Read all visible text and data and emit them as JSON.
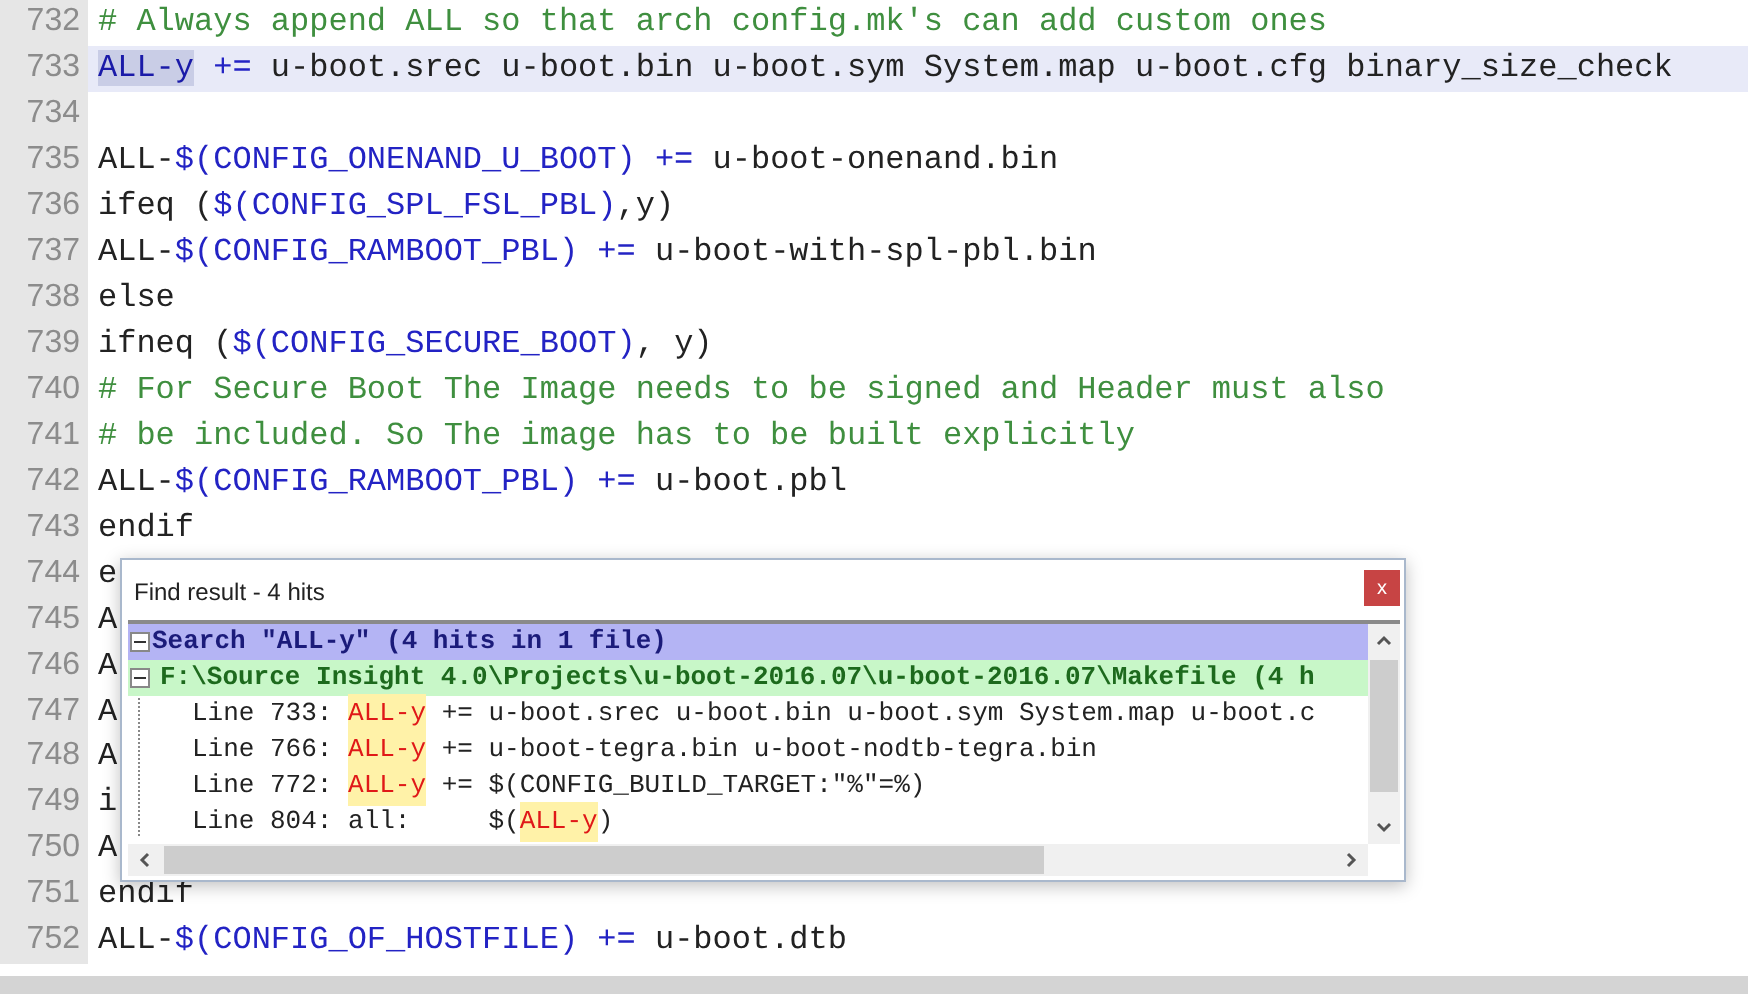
{
  "editor": {
    "lines": [
      {
        "number": "732",
        "current": false,
        "segments": [
          {
            "text": "# Always append ALL so that arch config.mk's can add custom ones",
            "kind": "comment"
          }
        ]
      },
      {
        "number": "733",
        "current": true,
        "segments": [
          {
            "text": "ALL-y",
            "kind": "selected"
          },
          {
            "text": " +=",
            "kind": "op"
          },
          {
            "text": " u-boot.srec u-boot.bin u-boot.sym System.map u-boot.cfg binary_size_check",
            "kind": "plain"
          }
        ]
      },
      {
        "number": "734",
        "current": false
      },
      {
        "number": "735",
        "current": false,
        "segments": [
          {
            "text": "ALL-",
            "kind": "plain"
          },
          {
            "text": "$(CONFIG_ONENAND_U_BOOT)",
            "kind": "var"
          },
          {
            "text": " +=",
            "kind": "op"
          },
          {
            "text": " u-boot-onenand.bin",
            "kind": "plain"
          }
        ]
      },
      {
        "number": "736",
        "current": false,
        "segments": [
          {
            "text": "ifeq (",
            "kind": "plain"
          },
          {
            "text": "$(CONFIG_SPL_FSL_PBL)",
            "kind": "var"
          },
          {
            "text": ",y)",
            "kind": "plain"
          }
        ]
      },
      {
        "number": "737",
        "current": false,
        "segments": [
          {
            "text": "ALL-",
            "kind": "plain"
          },
          {
            "text": "$(CONFIG_RAMBOOT_PBL)",
            "kind": "var"
          },
          {
            "text": " +=",
            "kind": "op"
          },
          {
            "text": " u-boot-with-spl-pbl.bin",
            "kind": "plain"
          }
        ]
      },
      {
        "number": "738",
        "current": false,
        "segments": [
          {
            "text": "else",
            "kind": "plain"
          }
        ]
      },
      {
        "number": "739",
        "current": false,
        "segments": [
          {
            "text": "ifneq (",
            "kind": "plain"
          },
          {
            "text": "$(CONFIG_SECURE_BOOT)",
            "kind": "var"
          },
          {
            "text": ", y)",
            "kind": "plain"
          }
        ]
      },
      {
        "number": "740",
        "current": false,
        "segments": [
          {
            "text": "# For Secure Boot The Image needs to be signed and Header must also",
            "kind": "comment"
          }
        ]
      },
      {
        "number": "741",
        "current": false,
        "segments": [
          {
            "text": "# be included. So The image has to be built explicitly",
            "kind": "comment"
          }
        ]
      },
      {
        "number": "742",
        "current": false,
        "segments": [
          {
            "text": "ALL-",
            "kind": "plain"
          },
          {
            "text": "$(CONFIG_RAMBOOT_PBL)",
            "kind": "var"
          },
          {
            "text": " +=",
            "kind": "op"
          },
          {
            "text": " u-boot.pbl",
            "kind": "plain"
          }
        ]
      },
      {
        "number": "743",
        "current": false,
        "segments": [
          {
            "text": "endif",
            "kind": "plain"
          }
        ]
      },
      {
        "number": "744",
        "current": false,
        "segments": [
          {
            "text": "e",
            "kind": "plain"
          }
        ]
      },
      {
        "number": "745",
        "current": false,
        "segments": [
          {
            "text": "A",
            "kind": "plain"
          }
        ]
      },
      {
        "number": "746",
        "current": false,
        "segments": [
          {
            "text": "A",
            "kind": "plain"
          }
        ]
      },
      {
        "number": "747",
        "current": false,
        "segments": [
          {
            "text": "A",
            "kind": "plain"
          }
        ]
      },
      {
        "number": "748",
        "current": false,
        "segments": [
          {
            "text": "A",
            "kind": "plain"
          }
        ]
      },
      {
        "number": "749",
        "current": false,
        "segments": [
          {
            "text": "i",
            "kind": "plain"
          }
        ]
      },
      {
        "number": "750",
        "current": false,
        "segments": [
          {
            "text": "A",
            "kind": "plain"
          }
        ]
      },
      {
        "number": "751",
        "current": false,
        "segments": [
          {
            "text": "endif",
            "kind": "plain"
          }
        ]
      },
      {
        "number": "752",
        "current": false,
        "segments": [
          {
            "text": "ALL-",
            "kind": "plain"
          },
          {
            "text": "$(CONFIG_OF_HOSTFILE)",
            "kind": "var"
          },
          {
            "text": " +=",
            "kind": "op"
          },
          {
            "text": " u-boot.dtb",
            "kind": "plain"
          }
        ]
      }
    ]
  },
  "find_result": {
    "title": "Find result - 4 hits",
    "close_label": "x",
    "rows": [
      {
        "kind": "search",
        "expanded": true,
        "segments": [
          {
            "text": "Search \"ALL-y\" (4 hits in 1 file)",
            "kind": "plain"
          }
        ]
      },
      {
        "kind": "file",
        "expanded": true,
        "segments": [
          {
            "text": "F:\\Source Insight 4.0\\Projects\\u-boot-2016.07\\u-boot-2016.07\\Makefile (4 h",
            "kind": "plain"
          }
        ]
      },
      {
        "kind": "hit",
        "segments": [
          {
            "text": "Line 733: ",
            "kind": "plain"
          },
          {
            "text": "ALL-y",
            "kind": "match"
          },
          {
            "text": " += u-boot.srec u-boot.bin u-boot.sym System.map u-boot.c",
            "kind": "plain"
          }
        ]
      },
      {
        "kind": "hit",
        "segments": [
          {
            "text": "Line 766: ",
            "kind": "plain"
          },
          {
            "text": "ALL-y",
            "kind": "match"
          },
          {
            "text": " += u-boot-tegra.bin u-boot-nodtb-tegra.bin",
            "kind": "plain"
          }
        ]
      },
      {
        "kind": "hit",
        "segments": [
          {
            "text": "Line 772: ",
            "kind": "plain"
          },
          {
            "text": "ALL-y",
            "kind": "match"
          },
          {
            "text": " += $(CONFIG_BUILD_TARGET:\"%\"=%)",
            "kind": "plain"
          }
        ]
      },
      {
        "kind": "hit",
        "segments": [
          {
            "text": "Line 804: all:     $(",
            "kind": "plain"
          },
          {
            "text": "ALL-y",
            "kind": "match"
          },
          {
            "text": ")",
            "kind": "plain"
          }
        ]
      }
    ]
  }
}
